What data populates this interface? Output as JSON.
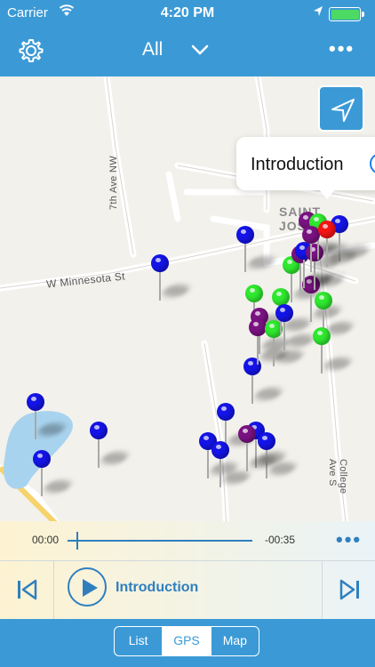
{
  "status_bar": {
    "carrier": "Carrier",
    "time": "4:20 PM"
  },
  "nav": {
    "title": "All",
    "settings_icon": "gear-icon",
    "dropdown_icon": "chevron-down-icon",
    "more_icon": "more-icon",
    "more_glyph": "•••"
  },
  "map": {
    "street_labels": {
      "minnesota": "W Minnesota St",
      "seventh": "7th Ave NW",
      "college": "College Ave S",
      "town": "SAINT JOSEPH"
    },
    "callout_title": "Introduction",
    "locate_icon": "location-arrow-icon",
    "pin_colors": {
      "blue": "#1414e8",
      "green": "#2fe82f",
      "purple": "#7a1282",
      "red": "#f51414"
    }
  },
  "player": {
    "elapsed": "00:00",
    "remaining": "-00:35",
    "progress": 0.05,
    "track_title": "Introduction",
    "more_glyph": "•••"
  },
  "tabs": [
    {
      "label": "List",
      "active": false
    },
    {
      "label": "GPS",
      "active": true
    },
    {
      "label": "Map",
      "active": false
    }
  ],
  "colors": {
    "brand": "#3b9ad6",
    "accent": "#2f7fbf"
  }
}
